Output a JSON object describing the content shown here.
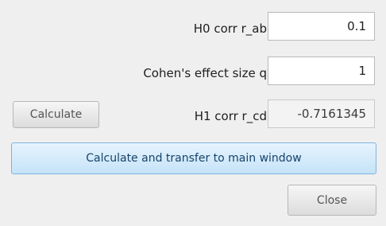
{
  "fields": {
    "h0_corr": {
      "label": "H0 corr r_ab",
      "value": "0.1"
    },
    "effect_size": {
      "label": "Cohen's effect size q",
      "value": "1"
    },
    "h1_corr": {
      "label": "H1 corr r_cd",
      "value": "-0.7161345"
    }
  },
  "buttons": {
    "calculate": "Calculate",
    "calculate_transfer": "Calculate and transfer to main window",
    "close": "Close"
  }
}
